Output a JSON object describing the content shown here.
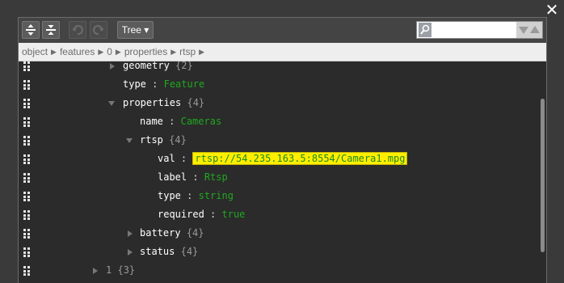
{
  "window": {
    "close_icon": "close-icon"
  },
  "toolbar": {
    "expand_all_icon": "expand-all-icon",
    "collapse_all_icon": "collapse-all-icon",
    "undo_icon": "undo-icon",
    "redo_icon": "redo-icon",
    "mode_label": "Tree ▾",
    "search": {
      "value": "",
      "placeholder": ""
    }
  },
  "breadcrumb": [
    "object",
    "features",
    "0",
    "properties",
    "rtsp"
  ],
  "tree": [
    {
      "key": "geometry",
      "count": "{2}",
      "state": "closed"
    },
    {
      "key": "type",
      "value": "Feature"
    },
    {
      "key": "properties",
      "count": "{4}",
      "state": "open"
    },
    {
      "key": "name",
      "value": "Cameras"
    },
    {
      "key": "rtsp",
      "count": "{4}",
      "state": "open"
    },
    {
      "key": "val",
      "value": "rtsp://54.235.163.5:8554/Camera1.mpg",
      "highlight": true
    },
    {
      "key": "label",
      "value": "Rtsp"
    },
    {
      "key": "type",
      "value": "string"
    },
    {
      "key": "required",
      "value": "true"
    },
    {
      "key": "battery",
      "count": "{4}",
      "state": "closed"
    },
    {
      "key": "status",
      "count": "{4}",
      "state": "closed"
    },
    {
      "key": "1",
      "count": "{3}",
      "state": "closed"
    }
  ]
}
